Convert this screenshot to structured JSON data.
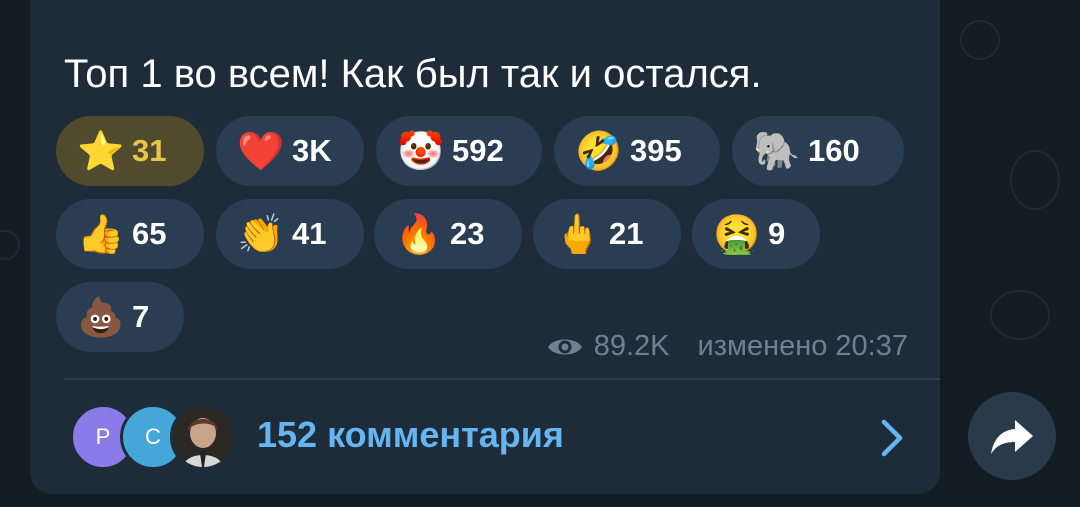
{
  "message": {
    "text": "Топ 1 во всем! Как был так и остался."
  },
  "reactions": [
    {
      "emoji": "⭐",
      "count": "31",
      "icon": "star-icon"
    },
    {
      "emoji": "❤️",
      "count": "3K",
      "icon": "heart-icon"
    },
    {
      "emoji": "🤡",
      "count": "592",
      "icon": "clown-face-icon"
    },
    {
      "emoji": "🤣",
      "count": "395",
      "icon": "rolling-laughing-icon"
    },
    {
      "emoji": "🐘",
      "count": "160",
      "icon": "elephant-icon"
    },
    {
      "emoji": "👍",
      "count": "65",
      "icon": "thumbs-up-icon"
    },
    {
      "emoji": "👏",
      "count": "41",
      "icon": "clapping-hands-icon"
    },
    {
      "emoji": "🔥",
      "count": "23",
      "icon": "fire-icon"
    },
    {
      "emoji": "🖕",
      "count": "21",
      "icon": "middle-finger-icon"
    },
    {
      "emoji": "🤮",
      "count": "9",
      "icon": "vomiting-face-icon"
    },
    {
      "emoji": "💩",
      "count": "7",
      "icon": "pile-of-poo-icon"
    }
  ],
  "meta": {
    "views": "89.2K",
    "edited": "изменено 20:37",
    "icon": "eye-icon"
  },
  "comments": {
    "label": "152 комментария",
    "avatars": [
      "Р",
      "С",
      ""
    ],
    "avatar_colors": [
      "#8b7be8",
      "#45a6d9",
      "#3a3530"
    ]
  },
  "colors": {
    "active_reaction": "#4f4b2c",
    "active_count": "#e9c44a",
    "link": "#64b5f2"
  }
}
